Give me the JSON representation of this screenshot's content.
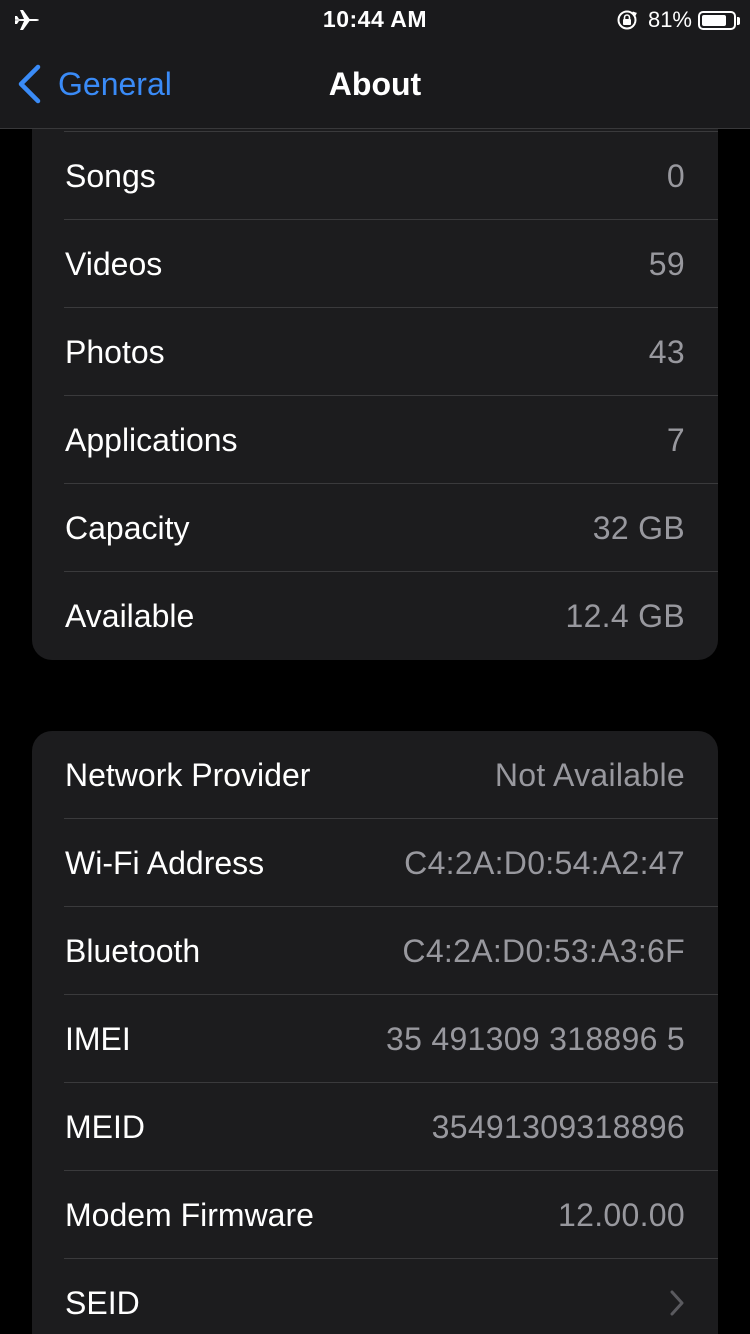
{
  "status_bar": {
    "time": "10:44 AM",
    "battery_percent": "81%",
    "battery_level": 0.81,
    "left_icon": "airplane-icon",
    "lock_icon": "rotation-lock-icon"
  },
  "nav": {
    "back_label": "General",
    "title": "About"
  },
  "colors": {
    "accent": "#3a8bf7",
    "background": "#000000",
    "group_background": "#1c1c1e",
    "secondary_text": "#98989e"
  },
  "group_1": {
    "rows": [
      {
        "label": "Songs",
        "value": "0"
      },
      {
        "label": "Videos",
        "value": "59"
      },
      {
        "label": "Photos",
        "value": "43"
      },
      {
        "label": "Applications",
        "value": "7"
      },
      {
        "label": "Capacity",
        "value": "32 GB"
      },
      {
        "label": "Available",
        "value": "12.4 GB"
      }
    ]
  },
  "group_2": {
    "rows": [
      {
        "label": "Network Provider",
        "value": "Not Available"
      },
      {
        "label": "Wi-Fi Address",
        "value": "C4:2A:D0:54:A2:47"
      },
      {
        "label": "Bluetooth",
        "value": "C4:2A:D0:53:A3:6F"
      },
      {
        "label": "IMEI",
        "value": "35 491309 318896 5"
      },
      {
        "label": "MEID",
        "value": "35491309318896"
      },
      {
        "label": "Modem Firmware",
        "value": "12.00.00"
      },
      {
        "label": "SEID",
        "value": ""
      }
    ]
  }
}
